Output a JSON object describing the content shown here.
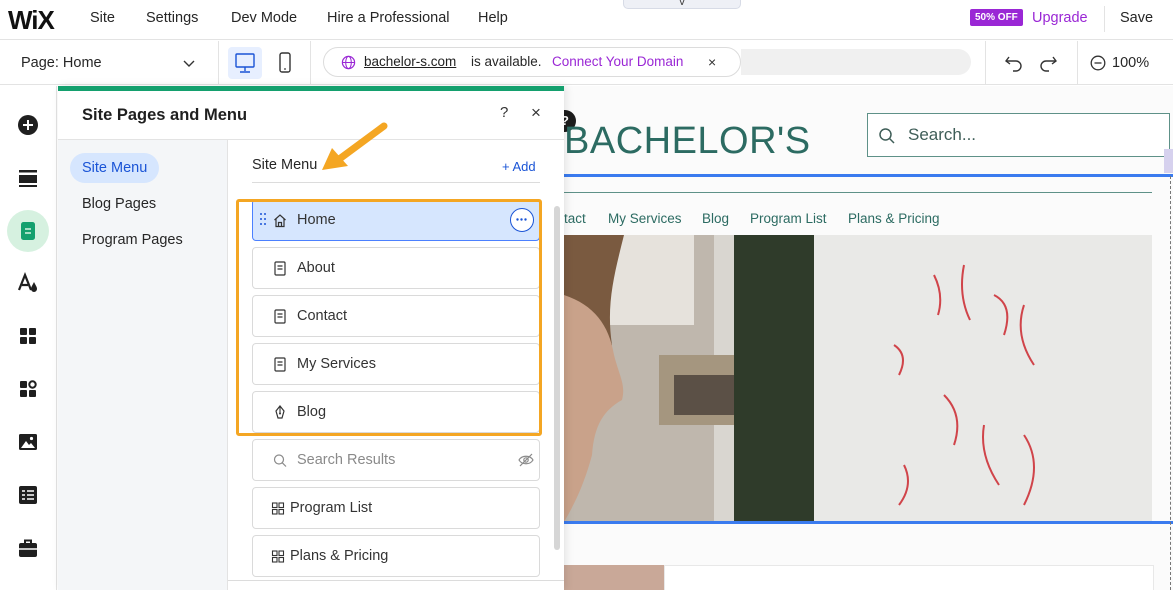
{
  "topbar": {
    "logo": "WiX",
    "menu": [
      "Site",
      "Settings",
      "Dev Mode",
      "Hire a Professional",
      "Help"
    ],
    "notch_glyph": "ᐯ",
    "badge": "50% OFF",
    "upgrade": "Upgrade",
    "save": "Save"
  },
  "toolbar": {
    "page_select": "Page: Home",
    "url_domain": "bachelor-s.com",
    "url_available": "is available.",
    "url_connect": "Connect Your Domain",
    "url_close": "×",
    "zoom": "100%"
  },
  "panel": {
    "title": "Site Pages and Menu",
    "help": "?",
    "close": "×",
    "categories": [
      "Site Menu",
      "Blog Pages",
      "Program Pages"
    ],
    "section_title": "Site Menu",
    "add_label": "+ Add",
    "items": [
      {
        "label": "Home",
        "icon": "home-icon"
      },
      {
        "label": "About",
        "icon": "page-icon"
      },
      {
        "label": "Contact",
        "icon": "page-icon"
      },
      {
        "label": "My Services",
        "icon": "page-icon"
      },
      {
        "label": "Blog",
        "icon": "pen-icon"
      },
      {
        "label": "Search Results",
        "icon": "search-icon"
      },
      {
        "label": "Program List",
        "icon": "grid-icon"
      },
      {
        "label": "Plans & Pricing",
        "icon": "grid-icon"
      }
    ]
  },
  "site": {
    "brand": "BACHELOR'S",
    "search_placeholder": "Search...",
    "nav": [
      "tact",
      "My Services",
      "Blog",
      "Program List",
      "Plans & Pricing"
    ],
    "help_badge": "?"
  },
  "colors": {
    "accent_blue": "#1a54d6",
    "upgrade_purple": "#9a27d5",
    "panel_green": "#14a06e",
    "highlight_orange": "#f4a623",
    "site_teal": "#2c6b62"
  }
}
